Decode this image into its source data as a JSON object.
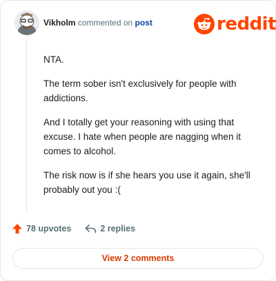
{
  "comment": {
    "username": "Vikholm",
    "action_text": "commented on",
    "post_link": "post",
    "paragraphs": [
      "NTA.",
      "The term sober isn't exclusively for people with addictions.",
      "And I totally get your reasoning with using that excuse. I hate when people are nagging when it comes to alcohol.",
      "The risk now is if she hears you use it again, she'll probably out you :("
    ]
  },
  "brand": {
    "wordmark": "reddit",
    "color": "#ff4500"
  },
  "footer": {
    "upvotes": "78 upvotes",
    "replies": "2 replies",
    "view_comments": "View 2 comments"
  },
  "icons": {
    "avatar": "avatar",
    "logo": "reddit-snoo-icon",
    "upvote": "upvote-arrow-icon",
    "reply": "reply-arrow-icon"
  }
}
